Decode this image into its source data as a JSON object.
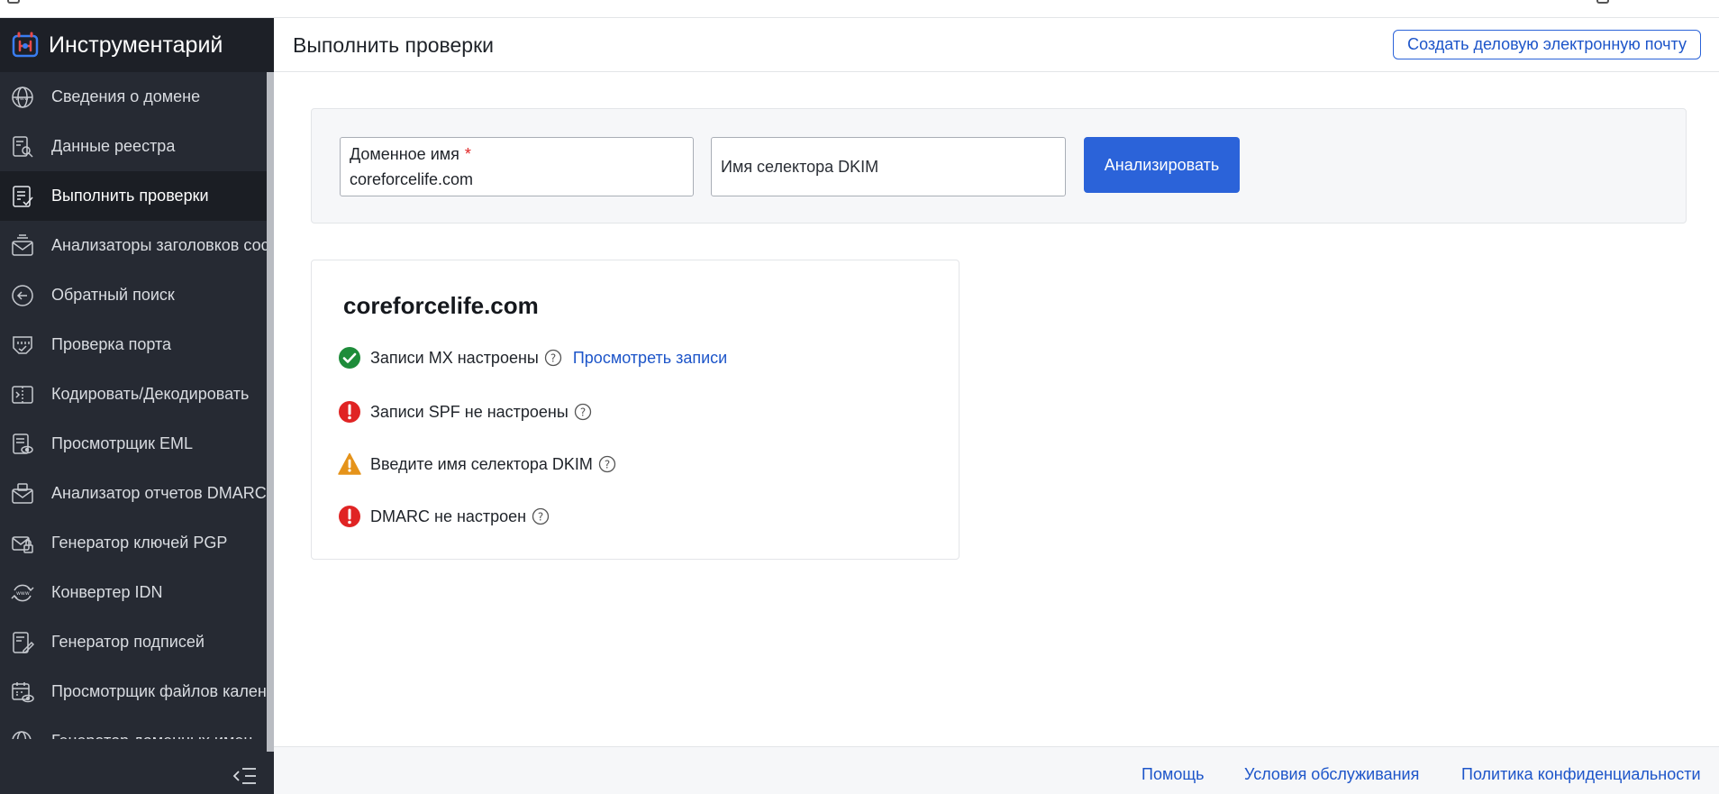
{
  "app": {
    "title": "Инструментарий",
    "colors": {
      "sidebar": "#262a33",
      "accent": "#2b63d9",
      "success": "#1e8c3a",
      "error": "#e02424",
      "warning": "#e5931a"
    }
  },
  "sidebar": {
    "items": [
      {
        "label": "Сведения о домене",
        "icon": "globe-www-icon"
      },
      {
        "label": "Данные реестра",
        "icon": "registry-search-icon"
      },
      {
        "label": "Выполнить проверки",
        "icon": "checklist-icon",
        "active": true
      },
      {
        "label": "Анализаторы заголовков сос",
        "icon": "mail-header-icon"
      },
      {
        "label": "Обратный поиск",
        "icon": "reverse-arrow-icon"
      },
      {
        "label": "Проверка порта",
        "icon": "port-icon"
      },
      {
        "label": "Кодировать/Декодировать",
        "icon": "encode-icon"
      },
      {
        "label": "Просмотрщик EML",
        "icon": "eml-viewer-icon"
      },
      {
        "label": "Анализатор отчетов DMARC",
        "icon": "dmarc-report-icon"
      },
      {
        "label": "Генератор ключей PGP",
        "icon": "pgp-key-icon"
      },
      {
        "label": "Конвертер IDN",
        "icon": "idn-converter-icon"
      },
      {
        "label": "Генератор подписей",
        "icon": "signature-icon"
      },
      {
        "label": "Просмотрщик файлов кален",
        "icon": "calendar-viewer-icon"
      },
      {
        "label": "Генератор доменных имен",
        "icon": "domain-generator-icon"
      }
    ],
    "collapse_icon": "collapse-menu-icon"
  },
  "header": {
    "title": "Выполнить проверки",
    "create_mail_label": "Создать деловую электронную почту"
  },
  "search": {
    "domain_label": "Доменное имя",
    "required_mark": "*",
    "domain_value": "coreforcelife.com",
    "dkim_placeholder": "Имя селектора DKIM",
    "analyze_label": "Анализировать"
  },
  "results": {
    "domain": "coreforcelife.com",
    "checks": [
      {
        "status": "success",
        "text": "Записи MX настроены",
        "link": "Просмотреть записи"
      },
      {
        "status": "error",
        "text": "Записи SPF не настроены"
      },
      {
        "status": "warning",
        "text": "Введите имя селектора DKIM"
      },
      {
        "status": "error",
        "text": "DMARC не настроен"
      }
    ]
  },
  "footer": {
    "help": "Помощь",
    "terms": "Условия обслуживания",
    "privacy": "Политика конфиденциальности"
  }
}
